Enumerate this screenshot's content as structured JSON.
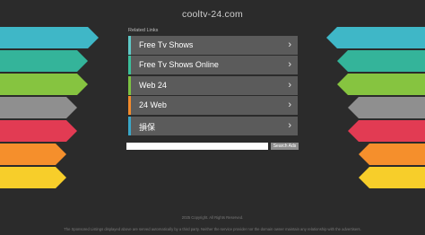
{
  "header": {
    "site_title": "cooltv-24.com"
  },
  "related": {
    "label": "Related Links",
    "items": [
      {
        "label": "Free Tv Shows",
        "accent": "#5fc9c7",
        "chevron": "›"
      },
      {
        "label": "Free Tv Shows Online",
        "accent": "#3bbf9b",
        "chevron": "›"
      },
      {
        "label": "Web 24",
        "accent": "#7dc242",
        "chevron": "›"
      },
      {
        "label": "24 Web",
        "accent": "#f28b2c",
        "chevron": "›"
      },
      {
        "label": "損保",
        "accent": "#3aa7c8",
        "chevron": "›"
      }
    ]
  },
  "search": {
    "placeholder": "",
    "button_label": "Search Ads"
  },
  "footer": {
    "copyright": "2025 Copyright. All Rights Reserved.",
    "disclaimer": "The Sponsored Listings displayed above are served automatically by a third party. Neither the service provider nor the domain owner maintain any relationship with the advertisers."
  },
  "decoration": {
    "left_arrows": [
      {
        "color": "#3fb7c7",
        "icon": "arrow-right-icon"
      },
      {
        "color": "#34b49a",
        "icon": "arrow-right-icon"
      },
      {
        "color": "#86c440",
        "icon": "arrow-right-icon"
      },
      {
        "color": "#8f8f8f",
        "icon": "arrow-right-icon"
      },
      {
        "color": "#e23b53",
        "icon": "arrow-right-icon"
      },
      {
        "color": "#f58f2c",
        "icon": "arrow-right-icon"
      },
      {
        "color": "#f7ce2a",
        "icon": "arrow-right-icon"
      }
    ],
    "right_arrows": [
      {
        "color": "#3fb7c7",
        "icon": "arrow-left-icon"
      },
      {
        "color": "#34b49a",
        "icon": "arrow-left-icon"
      },
      {
        "color": "#86c440",
        "icon": "arrow-left-icon"
      },
      {
        "color": "#8f8f8f",
        "icon": "arrow-left-icon"
      },
      {
        "color": "#e23b53",
        "icon": "arrow-left-icon"
      },
      {
        "color": "#f58f2c",
        "icon": "arrow-left-icon"
      },
      {
        "color": "#f7ce2a",
        "icon": "arrow-left-icon"
      }
    ]
  },
  "colors": {
    "background": "#2b2b2b",
    "panel": "#5b5b5b",
    "search_button": "#8d8d8d"
  }
}
